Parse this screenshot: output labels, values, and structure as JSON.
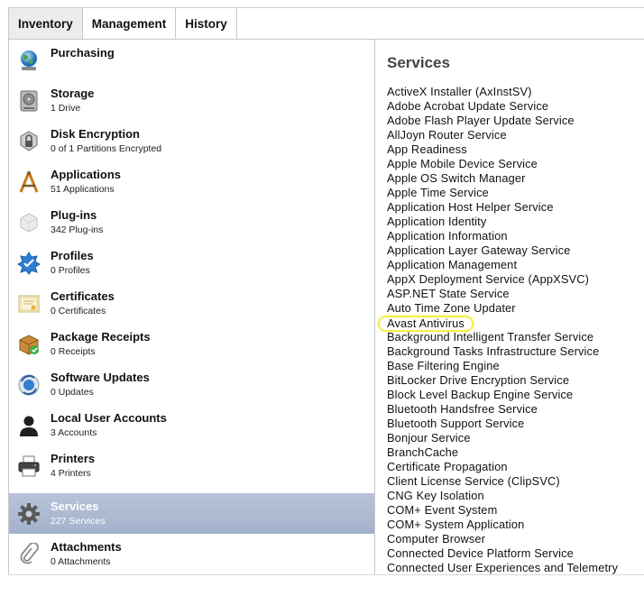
{
  "tabs": [
    {
      "label": "Inventory",
      "active": true
    },
    {
      "label": "Management",
      "active": false
    },
    {
      "label": "History",
      "active": false
    }
  ],
  "sidebar": {
    "items": [
      {
        "title": "Purchasing",
        "sub": "",
        "icon": "globe-icon"
      },
      {
        "title": "Storage",
        "sub": "1 Drive",
        "icon": "hard-drive-icon"
      },
      {
        "title": "Disk Encryption",
        "sub": "0 of 1 Partitions Encrypted",
        "icon": "lock-icon"
      },
      {
        "title": "Applications",
        "sub": "51 Applications",
        "icon": "applications-icon"
      },
      {
        "title": "Plug-ins",
        "sub": "342 Plug-ins",
        "icon": "plugin-icon"
      },
      {
        "title": "Profiles",
        "sub": "0 Profiles",
        "icon": "profile-badge-icon"
      },
      {
        "title": "Certificates",
        "sub": "0 Certificates",
        "icon": "certificate-icon"
      },
      {
        "title": "Package Receipts",
        "sub": "0 Receipts",
        "icon": "package-icon"
      },
      {
        "title": "Software Updates",
        "sub": "0 Updates",
        "icon": "software-update-icon"
      },
      {
        "title": "Local User Accounts",
        "sub": "3 Accounts",
        "icon": "user-icon"
      },
      {
        "title": "Printers",
        "sub": "4 Printers",
        "icon": "printer-icon"
      },
      {
        "title": "Services",
        "sub": "227 Services",
        "icon": "gear-icon",
        "selected": true
      },
      {
        "title": "Attachments",
        "sub": "0 Attachments",
        "icon": "paperclip-icon"
      }
    ]
  },
  "content": {
    "title": "Services",
    "highlighted": "Avast Antivirus",
    "services": [
      "ActiveX Installer (AxInstSV)",
      "Adobe Acrobat Update Service",
      "Adobe Flash Player Update Service",
      "AllJoyn Router Service",
      "App Readiness",
      "Apple Mobile Device Service",
      "Apple OS Switch Manager",
      "Apple Time Service",
      "Application Host Helper Service",
      "Application Identity",
      "Application Information",
      "Application Layer Gateway Service",
      "Application Management",
      "AppX Deployment Service (AppXSVC)",
      "ASP.NET State Service",
      "Auto Time Zone Updater",
      "Avast Antivirus",
      "Background Intelligent Transfer Service",
      "Background Tasks Infrastructure Service",
      "Base Filtering Engine",
      "BitLocker Drive Encryption Service",
      "Block Level Backup Engine Service",
      "Bluetooth Handsfree Service",
      "Bluetooth Support Service",
      "Bonjour Service",
      "BranchCache",
      "Certificate Propagation",
      "Client License Service (ClipSVC)",
      "CNG Key Isolation",
      "COM+ Event System",
      "COM+ System Application",
      "Computer Browser",
      "Connected Device Platform Service",
      "Connected User Experiences and Telemetry"
    ]
  }
}
